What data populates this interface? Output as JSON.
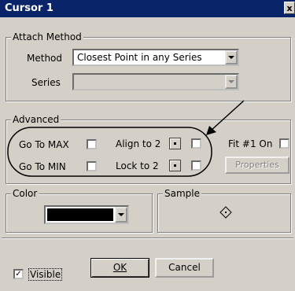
{
  "window": {
    "title": "Cursor 1",
    "close_label": "x"
  },
  "attach": {
    "legend": "Attach Method",
    "method_label": "Method",
    "method_value": "Closest Point in any Series",
    "series_label": "Series",
    "series_value": ""
  },
  "advanced": {
    "legend": "Advanced",
    "go_to_max": "Go To MAX",
    "go_to_min": "Go To MIN",
    "align_to_2": "Align to 2",
    "lock_to_2": "Lock to 2",
    "fit_on": "Fit #1 On",
    "properties": "Properties"
  },
  "color": {
    "legend": "Color",
    "value_color": "#000000"
  },
  "sample": {
    "legend": "Sample"
  },
  "footer": {
    "visible_label": "Visible",
    "visible_checked": "✓",
    "ok": "OK",
    "cancel": "Cancel"
  }
}
